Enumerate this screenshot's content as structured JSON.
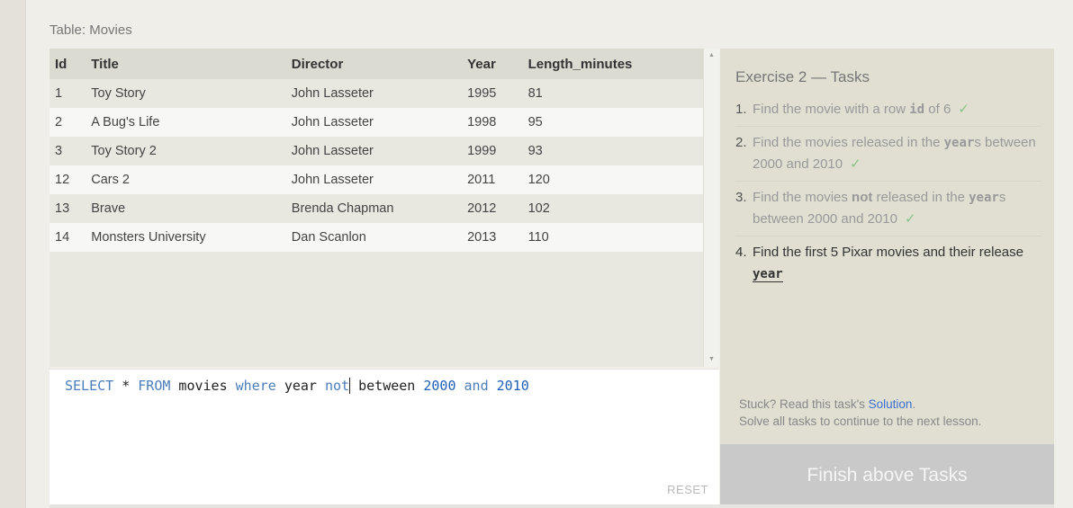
{
  "table_caption": "Table: Movies",
  "columns": [
    "Id",
    "Title",
    "Director",
    "Year",
    "Length_minutes"
  ],
  "rows": [
    [
      "1",
      "Toy Story",
      "John Lasseter",
      "1995",
      "81"
    ],
    [
      "2",
      "A Bug's Life",
      "John Lasseter",
      "1998",
      "95"
    ],
    [
      "3",
      "Toy Story 2",
      "John Lasseter",
      "1999",
      "93"
    ],
    [
      "12",
      "Cars 2",
      "John Lasseter",
      "2011",
      "120"
    ],
    [
      "13",
      "Brave",
      "Brenda Chapman",
      "2012",
      "102"
    ],
    [
      "14",
      "Monsters University",
      "Dan Scanlon",
      "2013",
      "110"
    ]
  ],
  "editor": {
    "tokens": [
      {
        "text": "SELECT",
        "cls": "kw"
      },
      {
        "text": " * ",
        "cls": ""
      },
      {
        "text": "FROM",
        "cls": "kw"
      },
      {
        "text": " movies ",
        "cls": ""
      },
      {
        "text": "where",
        "cls": "kw"
      },
      {
        "text": " year ",
        "cls": ""
      },
      {
        "text": "not",
        "cls": "kw"
      },
      {
        "text": "|",
        "cls": "caret"
      },
      {
        "text": " between ",
        "cls": ""
      },
      {
        "text": "2000",
        "cls": "num"
      },
      {
        "text": " ",
        "cls": ""
      },
      {
        "text": "and",
        "cls": "kw"
      },
      {
        "text": " ",
        "cls": ""
      },
      {
        "text": "2010",
        "cls": "num"
      }
    ],
    "reset_label": "RESET"
  },
  "tasks": {
    "title": "Exercise 2 — Tasks",
    "items": [
      {
        "num": "1.",
        "parts": [
          {
            "t": "Find the movie with a row "
          },
          {
            "t": "id",
            "mono": true
          },
          {
            "t": " of 6"
          }
        ],
        "done": true
      },
      {
        "num": "2.",
        "parts": [
          {
            "t": "Find the movies released in the "
          },
          {
            "t": "year",
            "mono": true
          },
          {
            "t": "s between 2000 and 2010"
          }
        ],
        "done": true
      },
      {
        "num": "3.",
        "parts": [
          {
            "t": "Find the movies "
          },
          {
            "t": "not",
            "bold": true
          },
          {
            "t": " released in the "
          },
          {
            "t": "year",
            "mono": true
          },
          {
            "t": "s between 2000 and 2010"
          }
        ],
        "done": true
      },
      {
        "num": "4.",
        "parts": [
          {
            "t": "Find the first 5 Pixar movies and their release "
          },
          {
            "t": "year",
            "mono": true
          }
        ],
        "done": false
      }
    ],
    "check_glyph": "✓",
    "stuck_prefix": "Stuck? Read this task's ",
    "solution_link": "Solution",
    "stuck_suffix": ".",
    "continue_note": "Solve all tasks to continue to the next lesson."
  },
  "finish_button": "Finish above Tasks"
}
